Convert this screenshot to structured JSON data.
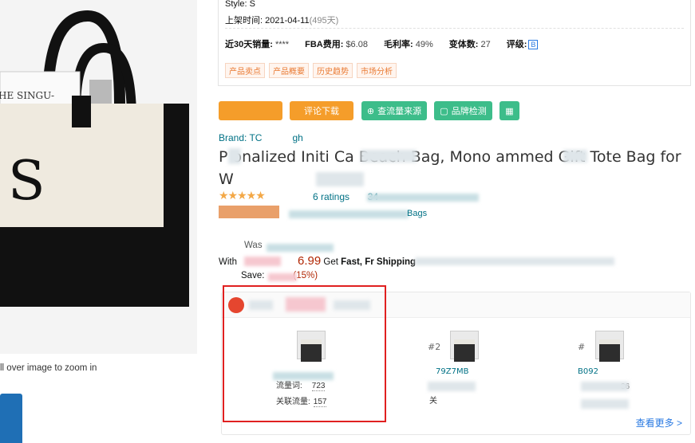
{
  "image_area": {
    "zoom_hint": "ll over image to zoom in"
  },
  "info": {
    "style_line": "Style: S",
    "listed_label": "上架时间:",
    "listed_date": "2021-04-11",
    "listed_days": "(495天)",
    "stats": {
      "sales_label": "近30天销量:",
      "sales_value": "****",
      "fba_label": "FBA费用:",
      "fba_value": "$6.08",
      "margin_label": "毛利率:",
      "margin_value": "49%",
      "variants_label": "变体数:",
      "variants_value": "27",
      "grade_label": "评级:",
      "grade_value": "B"
    },
    "tags": [
      "产品卖点",
      "产品概要",
      "历史趋势",
      "市场分析"
    ]
  },
  "toolbar": {
    "review_download": "评论下载",
    "traffic_source": "查流量来源",
    "brand_check": "品牌检测",
    "calc_icon_label": "▦"
  },
  "product": {
    "brand_prefix": "Brand: TC",
    "brand_suffix": "gh",
    "title": "P    onalized Initi   Ca      Beach Bag, Mono    ammed Gift Tote Bag for W",
    "stars": "★★★★★",
    "ratings": "6 ratings",
    "ratings_extra": "34",
    "category_link": "Bags",
    "was_label": "Was",
    "with_label": "With",
    "price": "6.99",
    "get_fast": "Get",
    "fast": "Fast,",
    "free_shipping": "Fr   Shipping",
    "save_label": "Save:",
    "save_pct": "(15%)"
  },
  "related": {
    "cards": [
      {
        "rank": "",
        "asin": "",
        "metric1_label": "流量词:",
        "metric1_value": "723",
        "metric2_label": "关联流量:",
        "metric2_value": "157"
      },
      {
        "rank": "#2",
        "asin": "79Z7MB",
        "metric1_label": "",
        "metric1_value": "",
        "metric2_label": "关",
        "metric2_value": ""
      },
      {
        "rank": "#",
        "asin": "B092",
        "metric1_label": "",
        "metric1_value": "36",
        "metric2_label": "",
        "metric2_value": ""
      }
    ],
    "more_link": "查看更多 >"
  },
  "colors": {
    "accent_orange": "#f59d2a",
    "accent_green": "#3dbd8a",
    "link": "#007185",
    "price": "#b12704",
    "highlight_box": "#e02020"
  }
}
